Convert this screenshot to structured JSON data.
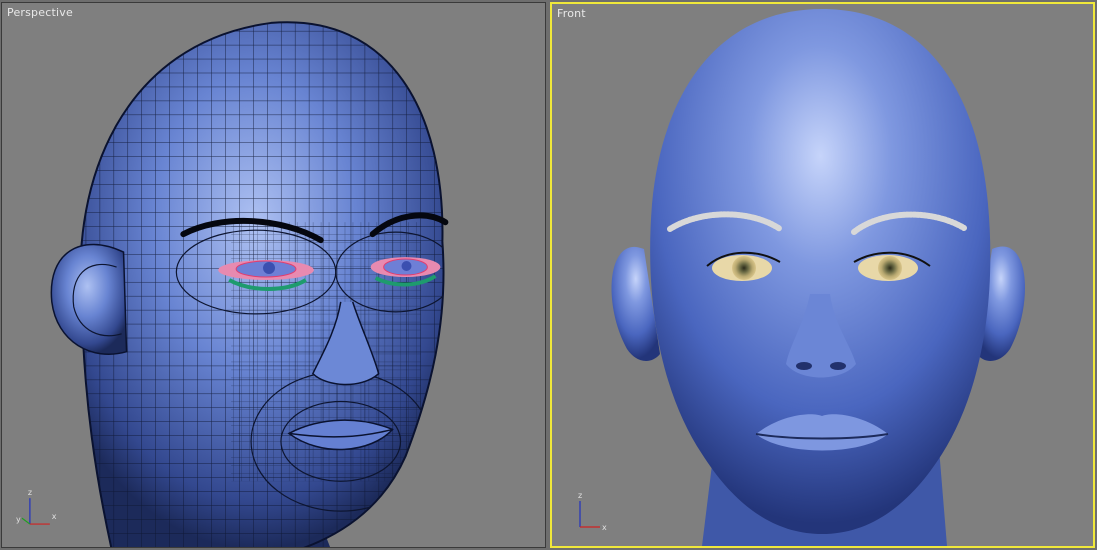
{
  "viewports": [
    {
      "label": "Perspective",
      "active": false,
      "axes": {
        "z": "z",
        "x": "x",
        "y": "y"
      }
    },
    {
      "label": "Front",
      "active": true,
      "axes": {
        "z": "z",
        "x": "x"
      }
    }
  ],
  "colors": {
    "viewport_bg": "#7f7f7f",
    "active_border": "#f0e83a",
    "head_base": "#5b79c9",
    "head_highlight": "#b7c8f5",
    "head_shadow": "#1d2b5c",
    "axis_x": "#d02020",
    "axis_y": "#20a020",
    "axis_z": "#2030c0"
  }
}
